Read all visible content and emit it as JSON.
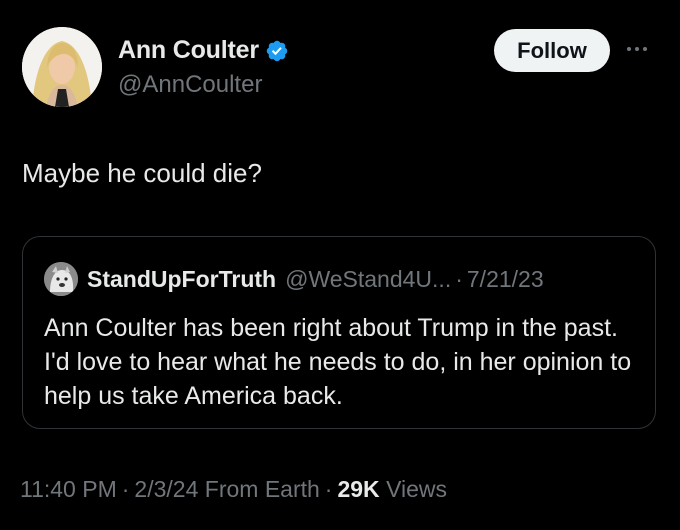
{
  "author": {
    "name": "Ann Coulter",
    "handle": "@AnnCoulter",
    "verified_icon": "verified-badge-icon",
    "verified_color": "#1d9bf0"
  },
  "actions": {
    "follow_label": "Follow",
    "more_icon": "more-options-icon"
  },
  "tweet": {
    "text": "Maybe he could die?"
  },
  "quote": {
    "name": "StandUpForTruth",
    "handle": "@WeStand4U...",
    "separator": "·",
    "date": "7/21/23",
    "text": "Ann Coulter has been right about Trump in the past. I'd love to hear what he needs to do, in her opinion to help us take America back."
  },
  "meta": {
    "time": "11:40 PM",
    "date": "2/3/24",
    "source": "From Earth",
    "views_count": "29K",
    "views_label": "Views",
    "separator": "·"
  },
  "colors": {
    "background": "#000000",
    "text_primary": "#e7e9ea",
    "text_secondary": "#71767b",
    "border": "#2f3336",
    "follow_bg": "#eff3f4"
  }
}
